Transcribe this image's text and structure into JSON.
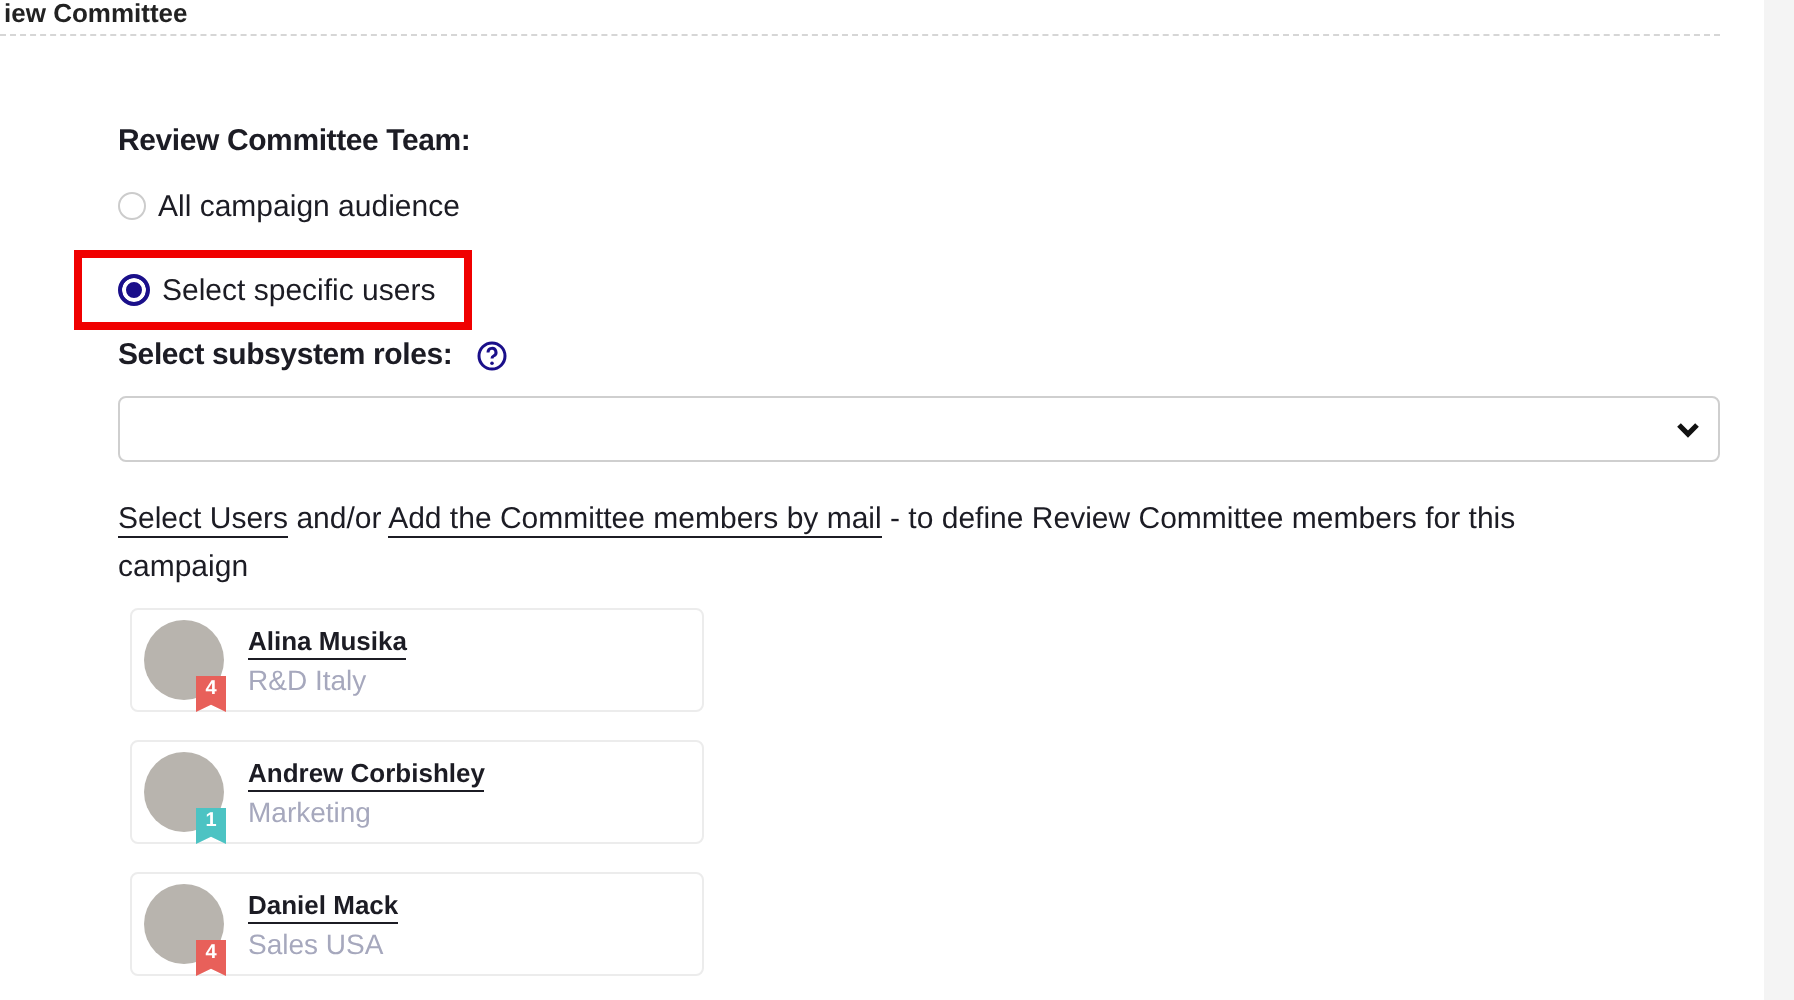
{
  "section_title": "iew Committee",
  "team": {
    "label": "Review Committee Team:",
    "options": [
      {
        "label": "All campaign audience",
        "selected": false,
        "highlighted": false
      },
      {
        "label": "Select specific users",
        "selected": true,
        "highlighted": true
      }
    ]
  },
  "roles": {
    "label": "Select subsystem roles:"
  },
  "instructions": {
    "link_1": "Select Users",
    "middle": "and/or",
    "link_2": "Add the Committee members by mail",
    "rest": "- to define Review Committee members for this campaign"
  },
  "users": [
    {
      "name": "Alina Musika",
      "department": "R&D Italy",
      "badge": "4",
      "color": "#e8605a"
    },
    {
      "name": "Andrew Corbishley",
      "department": "Marketing",
      "badge": "1",
      "color": "#4cc3c3"
    },
    {
      "name": "Daniel Mack",
      "department": "Sales USA",
      "badge": "4",
      "color": "#e8605a"
    }
  ]
}
